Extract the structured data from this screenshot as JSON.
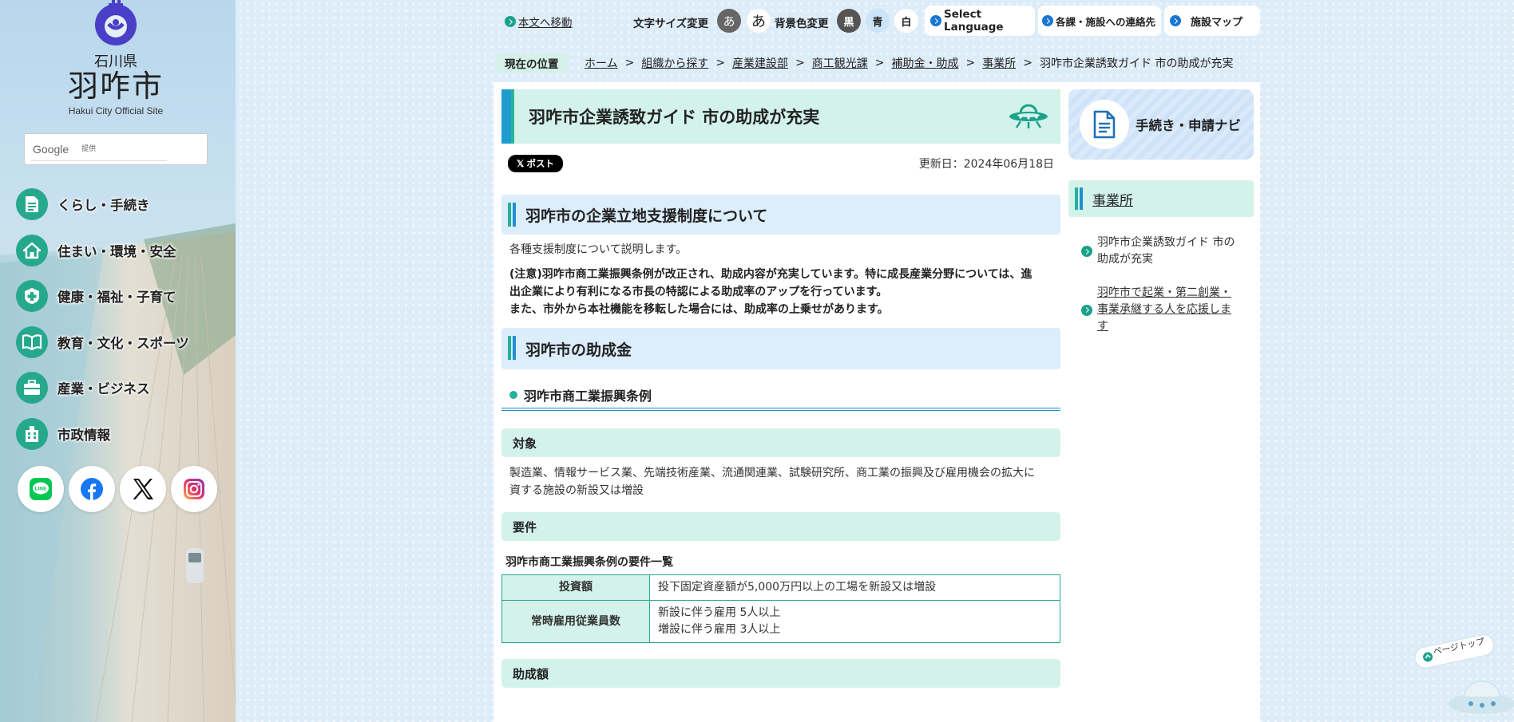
{
  "site": {
    "prefecture": "石川県",
    "city": "羽咋市",
    "english": "Hakui City Official Site"
  },
  "search": {
    "brand": "Google",
    "suffix": "提供"
  },
  "sidebar": {
    "items": [
      {
        "label": "くらし・手続き",
        "icon": "document-icon"
      },
      {
        "label": "住まい・環境・安全",
        "icon": "house-icon"
      },
      {
        "label": "健康・福祉・子育て",
        "icon": "medical-icon"
      },
      {
        "label": "教育・文化・スポーツ",
        "icon": "book-icon"
      },
      {
        "label": "産業・ビジネス",
        "icon": "briefcase-icon"
      },
      {
        "label": "市政情報",
        "icon": "building-icon"
      }
    ],
    "social": [
      "line-icon",
      "facebook-icon",
      "x-icon",
      "instagram-icon"
    ]
  },
  "topbar": {
    "skip": "本文へ移動",
    "font_size_label": "文字サイズ変更",
    "font_small": "あ",
    "font_large": "あ",
    "bg_label": "背景色変更",
    "bg_black": "黒",
    "bg_blue": "青",
    "bg_white": "白",
    "language": "Select Language",
    "contacts": "各課・施設への連絡先",
    "facility_map": "施設マップ"
  },
  "breadcrumb": {
    "label": "現在の位置",
    "items": [
      "ホーム",
      "組織から探す",
      "産業建設部",
      "商工観光課",
      "補助金・助成",
      "事業所"
    ],
    "current": "羽咋市企業誘致ガイド 市の助成が充実"
  },
  "article": {
    "title": "羽咋市企業誘致ガイド 市の助成が充実",
    "post_button": "ポスト",
    "updated": "更新日：2024年06月18日",
    "section1": {
      "heading": "羽咋市の企業立地支援制度について",
      "intro": "各種支援制度について説明します。",
      "note_line1": "(注意)羽咋市商工業振興条例が改正され、助成内容が充実しています。特に成長産業分野については、進",
      "note_line2": "出企業により有利になる市長の特認による助成率のアップを行っています。",
      "note_line3": "また、市外から本社機能を移転した場合には、助成率の上乗せがあります。"
    },
    "section2": {
      "heading": "羽咋市の助成金",
      "sub_heading": "羽咋市商工業振興条例",
      "target_heading": "対象",
      "target_line1": "製造業、情報サービス業、先端技術産業、流通関連業、試験研究所、商工業の振興及び雇用機会の拡大に",
      "target_line2": "資する施設の新設又は増設",
      "req_heading": "要件",
      "table_caption": "羽咋市商工業振興条例の要件一覧",
      "table": [
        {
          "head": "投資額",
          "lines": [
            "投下固定資産額が5,000万円以上の工場を新設又は増設"
          ]
        },
        {
          "head": "常時雇用従業員数",
          "lines": [
            "新設に伴う雇用 5人以上",
            "増設に伴う雇用 3人以上"
          ]
        }
      ],
      "amount_heading": "助成額"
    }
  },
  "right": {
    "navi": "手続き・申請ナビ",
    "section": "事業所",
    "links": [
      [
        "羽咋市企業誘致ガイド 市の",
        "助成が充実"
      ],
      [
        "羽咋市で起業・第二創業・",
        "事業承継する人を応援しま",
        "す"
      ]
    ]
  },
  "page_top": "ページトップ",
  "colors": {
    "accent_green": "#26a88d",
    "accent_blue": "#1f8fcf",
    "mint": "#d2f2ea",
    "light_blue": "#dcedfb"
  }
}
